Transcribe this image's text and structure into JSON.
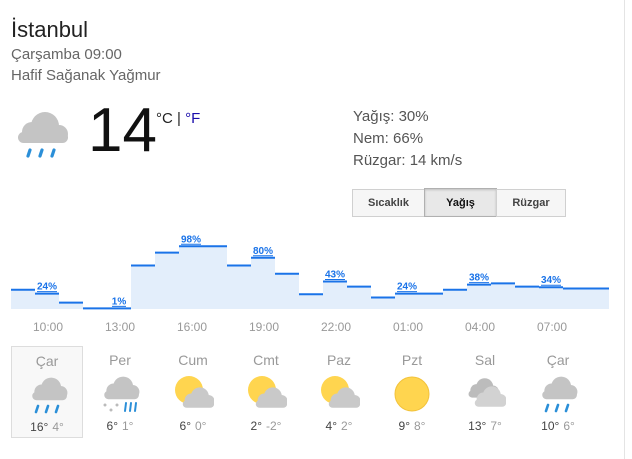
{
  "location": "İstanbul",
  "datetime": "Çarşamba 09:00",
  "condition": "Hafif Sağanak Yağmur",
  "current": {
    "temp": "14",
    "unit_c": "°C",
    "sep": " | ",
    "unit_f": "°F",
    "icon": "rain-cloud-icon"
  },
  "stats": {
    "precip": "Yağış: 30%",
    "humidity": "Nem: 66%",
    "wind": "Rüzgar: 14 km/s"
  },
  "tabs": [
    {
      "label": "Sıcaklık",
      "active": false
    },
    {
      "label": "Yağış",
      "active": true
    },
    {
      "label": "Rüzgar",
      "active": false
    }
  ],
  "colors": {
    "line": "#1a73e8",
    "fill": "#e3eefb",
    "label": "#1a73e8",
    "sun": "#ffd54f"
  },
  "hours": [
    "10:00",
    "13:00",
    "16:00",
    "19:00",
    "22:00",
    "01:00",
    "04:00",
    "07:00"
  ],
  "chart_data": {
    "type": "line",
    "x": [
      "09:00",
      "10:00",
      "11:00",
      "12:00",
      "13:00",
      "14:00",
      "15:00",
      "16:00",
      "17:00",
      "18:00",
      "19:00",
      "20:00",
      "21:00",
      "22:00",
      "23:00",
      "00:00",
      "01:00",
      "02:00",
      "03:00",
      "04:00",
      "05:00",
      "06:00",
      "07:00",
      "08:00",
      "09:00"
    ],
    "values": [
      30,
      24,
      10,
      1,
      1,
      68,
      88,
      98,
      98,
      68,
      80,
      55,
      23,
      43,
      35,
      18,
      24,
      24,
      30,
      38,
      40,
      35,
      34,
      32,
      32
    ],
    "labels": [
      "24%",
      "1%",
      "98%",
      "80%",
      "43%",
      "24%",
      "38%",
      "34%"
    ],
    "label_indices": [
      1,
      4,
      7,
      10,
      13,
      16,
      19,
      22
    ],
    "ylim": [
      0,
      100
    ]
  },
  "forecast": [
    {
      "day": "Çar",
      "hi": "16°",
      "lo": "4°",
      "icon": "rain-cloud-icon"
    },
    {
      "day": "Per",
      "hi": "6°",
      "lo": "1°",
      "icon": "sleet-cloud-icon"
    },
    {
      "day": "Cum",
      "hi": "6°",
      "lo": "0°",
      "icon": "partly-sunny-icon"
    },
    {
      "day": "Cmt",
      "hi": "2°",
      "lo": "-2°",
      "icon": "partly-sunny-icon"
    },
    {
      "day": "Paz",
      "hi": "4°",
      "lo": "2°",
      "icon": "partly-sunny-icon"
    },
    {
      "day": "Pzt",
      "hi": "9°",
      "lo": "8°",
      "icon": "sun-icon"
    },
    {
      "day": "Sal",
      "hi": "13°",
      "lo": "7°",
      "icon": "cloudy-icon"
    },
    {
      "day": "Çar",
      "hi": "10°",
      "lo": "6°",
      "icon": "rain-cloud-icon"
    }
  ]
}
